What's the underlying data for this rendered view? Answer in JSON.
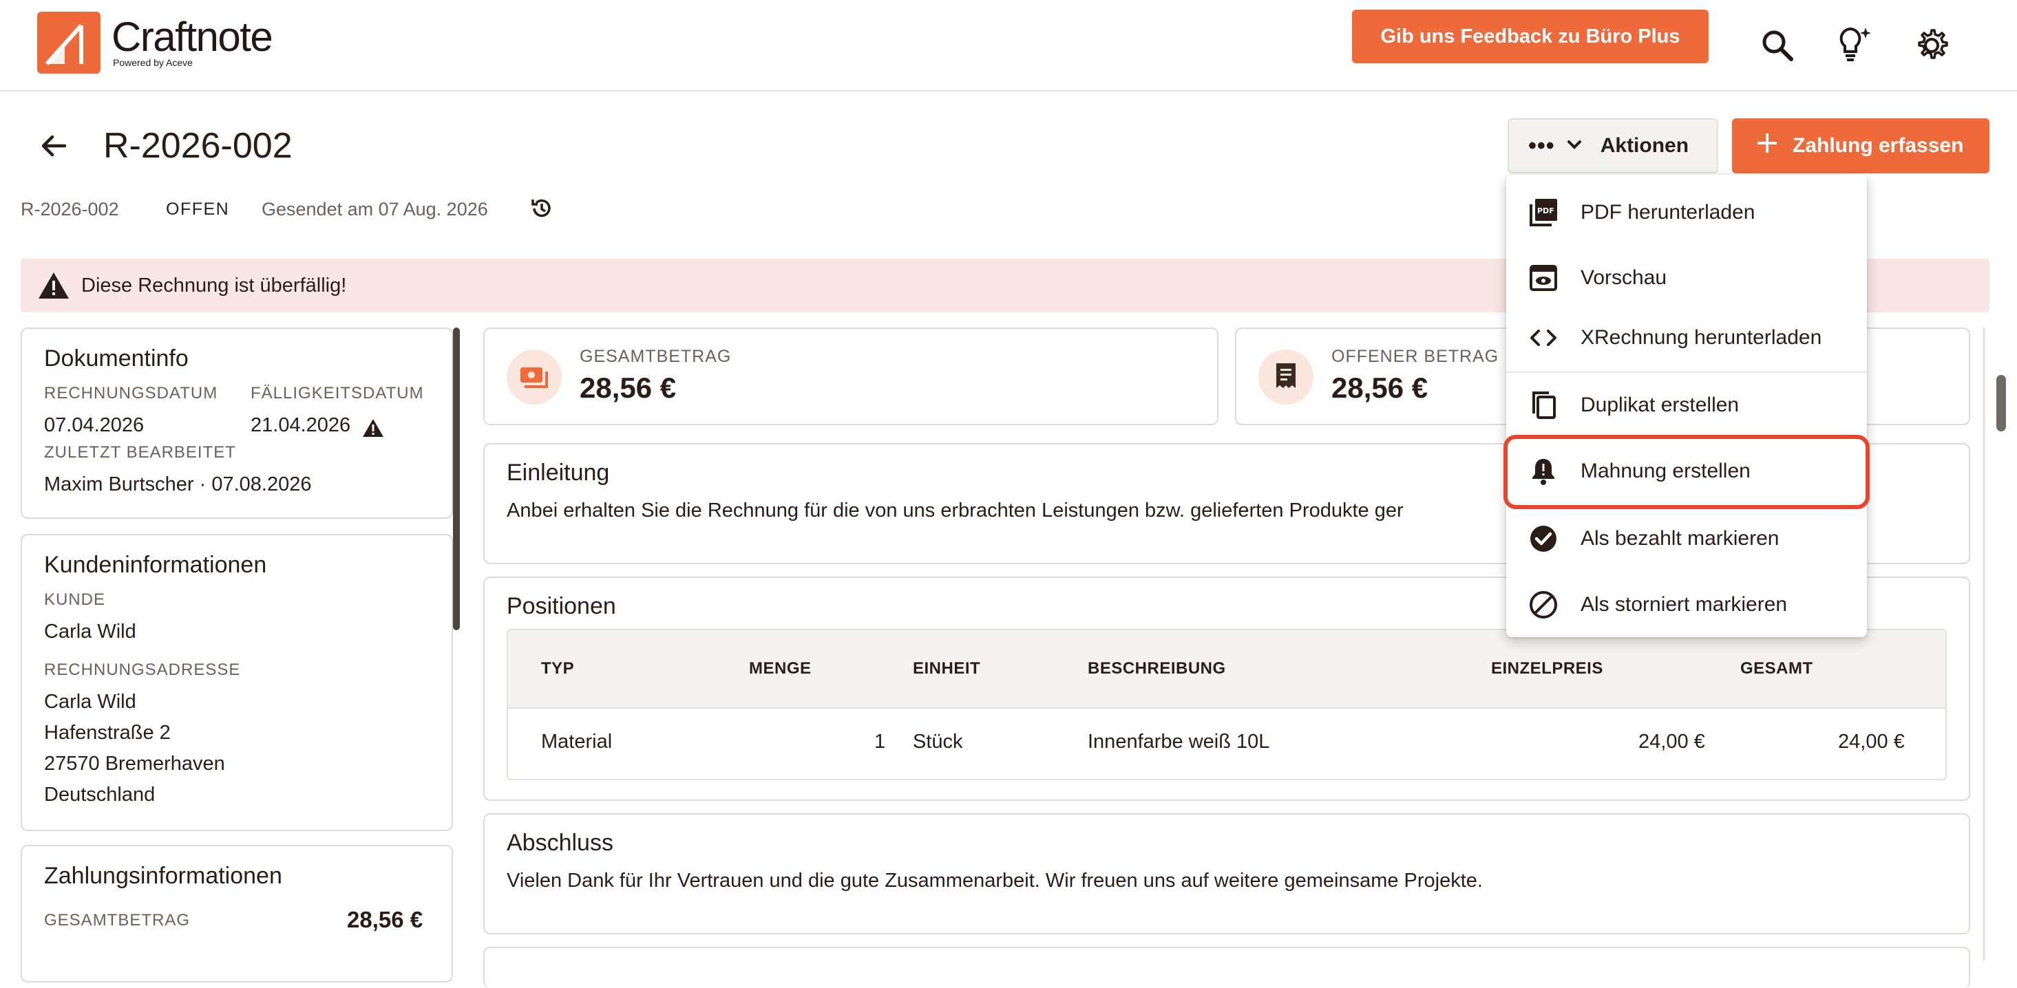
{
  "header": {
    "logo_name": "Craftnote",
    "logo_sub": "Powered by Aceve",
    "feedback_label": "Gib uns Feedback zu Büro Plus",
    "icons": [
      "search-icon",
      "lightbulb-sparkle-icon",
      "gear-icon"
    ]
  },
  "page": {
    "title": "R-2026-002",
    "meta_number": "R-2026-002",
    "meta_status": "OFFEN",
    "meta_sent": "Gesendet am 07 Aug. 2026",
    "aktionen_label": "Aktionen",
    "zahlung_label": "Zahlung erfassen"
  },
  "alert": {
    "text": "Diese Rechnung ist überfällig!"
  },
  "dokumentinfo": {
    "title": "Dokumentinfo",
    "rechnungsdatum_label": "RECHNUNGSDATUM",
    "rechnungsdatum": "07.04.2026",
    "faelligkeit_label": "FÄLLIGKEITSDATUM",
    "faelligkeit": "21.04.2026",
    "zuletzt_label": "ZULETZT BEARBEITET",
    "zuletzt": "Maxim Burtscher · 07.08.2026"
  },
  "kunde": {
    "title": "Kundeninformationen",
    "kunde_label": "KUNDE",
    "kunde": "Carla Wild",
    "adresse_label": "RECHNUNGSADRESSE",
    "adresse": [
      "Carla Wild",
      "Hafenstraße 2",
      "27570 Bremerhaven",
      "Deutschland"
    ]
  },
  "zahlung": {
    "title": "Zahlungsinformationen",
    "gesamt_label": "GESAMTBETRAG",
    "gesamt": "28,56 €"
  },
  "stats": {
    "gesamt_label": "GESAMTBETRAG",
    "gesamt": "28,56 €",
    "offen_label": "OFFENER BETRAG",
    "offen": "28,56 €"
  },
  "einleitung": {
    "title": "Einleitung",
    "text": "Anbei erhalten Sie die Rechnung für die von uns erbrachten Leistungen bzw. gelieferten Produkte ger"
  },
  "positionen": {
    "title": "Positionen",
    "columns": [
      "TYP",
      "MENGE",
      "EINHEIT",
      "BESCHREIBUNG",
      "EINZELPREIS",
      "GESAMT"
    ],
    "rows": [
      [
        "Material",
        "1",
        "Stück",
        "Innenfarbe weiß 10L",
        "24,00 €",
        "24,00 €"
      ]
    ]
  },
  "abschluss": {
    "title": "Abschluss",
    "text": "Vielen Dank für Ihr Vertrauen und die gute Zusammenarbeit. Wir freuen uns auf weitere gemeinsame Projekte."
  },
  "menu": {
    "items": [
      {
        "label": "PDF herunterladen",
        "icon": "pdf-icon"
      },
      {
        "label": "Vorschau",
        "icon": "eye-icon"
      },
      {
        "label": "XRechnung herunterladen",
        "icon": "code-icon"
      },
      {
        "label": "Duplikat erstellen",
        "icon": "copy-icon"
      },
      {
        "label": "Mahnung erstellen",
        "icon": "bell-alert-icon"
      },
      {
        "label": "Als bezahlt markieren",
        "icon": "check-circle-icon"
      },
      {
        "label": "Als storniert markieren",
        "icon": "block-icon"
      }
    ]
  },
  "colors": {
    "brand": "#ef6a3a",
    "alert_bg": "#f8e6e4",
    "highlight": "#e8452c",
    "text": "#2a1d18"
  }
}
